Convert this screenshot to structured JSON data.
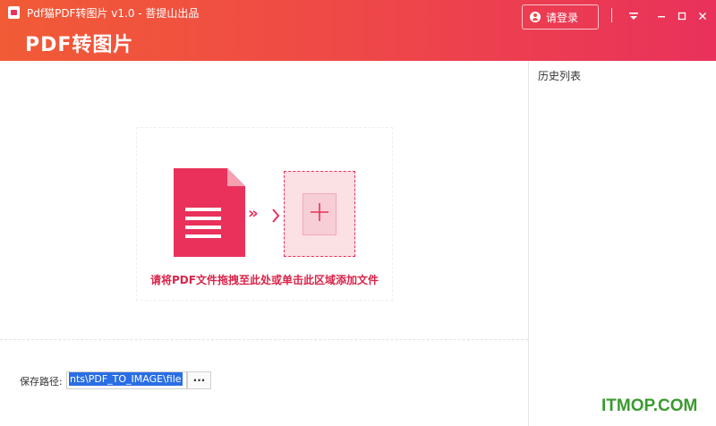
{
  "window": {
    "title": "Pdf猫PDF转图片 v1.0 - 菩提山出品",
    "brand": "PDF转图片",
    "login_label": "请登录"
  },
  "icons": {
    "app": "pdf-app-icon",
    "user": "user-icon",
    "menu": "menu-down-icon",
    "minimize": "minimize-icon",
    "maximize": "maximize-icon",
    "close": "close-icon"
  },
  "history": {
    "title": "历史列表"
  },
  "drop_zone": {
    "hint": "请将PDF文件拖拽至此处或单击此区域添加文件",
    "arrow_glyph": "»"
  },
  "save": {
    "label": "保存路径:",
    "path_value": "nts\\PDF_TO_IMAGE\\file",
    "browse_label": "···"
  },
  "watermark": "ITMOP.COM",
  "colors": {
    "accent": "#e9315b",
    "header_start": "#f15b36",
    "header_end": "#e9315b"
  }
}
